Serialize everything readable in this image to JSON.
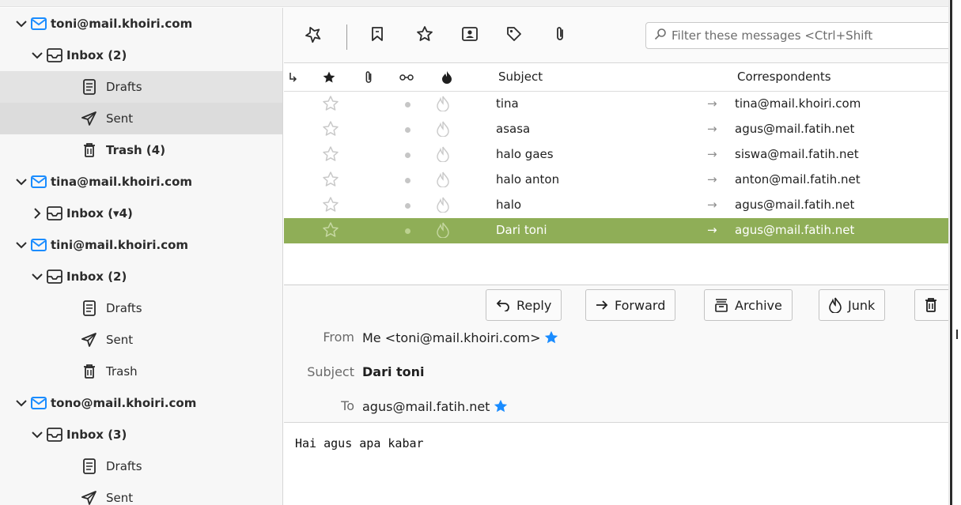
{
  "folder_pane": {
    "accounts": [
      {
        "email": "toni@mail.khoiri.com",
        "inbox": "Inbox (2)",
        "folders": [
          {
            "label": "Drafts",
            "icon": "drafts-icon"
          },
          {
            "label": "Sent",
            "icon": "sent-icon"
          },
          {
            "label": "Trash (4)",
            "icon": "trash-icon"
          }
        ]
      },
      {
        "email": "tina@mail.khoiri.com",
        "inbox": "Inbox (▾4)",
        "folders": []
      },
      {
        "email": "tini@mail.khoiri.com",
        "inbox": "Inbox (2)",
        "folders": [
          {
            "label": "Drafts",
            "icon": "drafts-icon"
          },
          {
            "label": "Sent",
            "icon": "sent-icon"
          },
          {
            "label": "Trash",
            "icon": "trash-icon"
          }
        ]
      },
      {
        "email": "tono@mail.khoiri.com",
        "inbox": "Inbox (3)",
        "folders": [
          {
            "label": "Drafts",
            "icon": "drafts-icon"
          },
          {
            "label": "Sent",
            "icon": "sent-icon"
          }
        ]
      }
    ]
  },
  "toolbar": {
    "filter_placeholder": "Filter these messages <Ctrl+Shift"
  },
  "thread_header": {
    "subject": "Subject",
    "correspondents": "Correspondents"
  },
  "messages": [
    {
      "subject": "tina",
      "correspondent": "tina@mail.khoiri.com",
      "selected": false
    },
    {
      "subject": "asasa",
      "correspondent": "agus@mail.fatih.net",
      "selected": false
    },
    {
      "subject": "halo gaes",
      "correspondent": "siswa@mail.fatih.net",
      "selected": false
    },
    {
      "subject": "halo anton",
      "correspondent": "anton@mail.fatih.net",
      "selected": false
    },
    {
      "subject": "halo",
      "correspondent": "agus@mail.fatih.net",
      "selected": false
    },
    {
      "subject": "Dari toni",
      "correspondent": "agus@mail.fatih.net",
      "selected": true
    }
  ],
  "actions": {
    "reply": "Reply",
    "forward": "Forward",
    "archive": "Archive",
    "junk": "Junk"
  },
  "message_header": {
    "from_label": "From",
    "from_value": "Me <toni@mail.khoiri.com>",
    "subject_label": "Subject",
    "subject_value": "Dari toni",
    "to_label": "To",
    "to_value": "agus@mail.fatih.net"
  },
  "message_body": "Hai agus apa kabar",
  "colors": {
    "selection": "#8fae57",
    "accent_blue": "#1a8cff",
    "envelope_blue": "#1a8cff"
  }
}
